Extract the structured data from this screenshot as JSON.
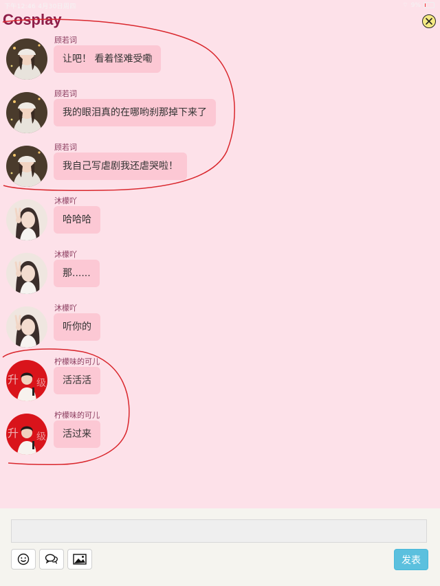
{
  "status_bar": {
    "time": "下午12:46",
    "date": "4月30日周四",
    "battery": "9%",
    "battery_level": 0.09
  },
  "app": {
    "title": "Cosplay"
  },
  "messages": [
    {
      "sender": "顾若词",
      "text": "让吧！  看着怪难受嘞",
      "avatar": "girl-beanie-avatar"
    },
    {
      "sender": "顾若词",
      "text": "我的眼泪真的在哪哟刹那掉下来了",
      "avatar": "girl-beanie-avatar"
    },
    {
      "sender": "顾若词",
      "text": "我自己写虐剧我还虐哭啦！",
      "avatar": "girl-beanie-avatar"
    },
    {
      "sender": "沐檬吖",
      "text": "哈哈哈",
      "avatar": "girl-peace-sign-avatar"
    },
    {
      "sender": "沐檬吖",
      "text": "那......",
      "avatar": "girl-peace-sign-avatar"
    },
    {
      "sender": "沐檬吖",
      "text": "听你的",
      "avatar": "girl-peace-sign-avatar"
    },
    {
      "sender": "柠檬味的可儿",
      "text": "活活活",
      "avatar": "boy-red-backdrop-avatar"
    },
    {
      "sender": "柠檬味的可儿",
      "text": "活过来",
      "avatar": "boy-red-backdrop-avatar"
    }
  ],
  "composer": {
    "input_value": "",
    "send_label": "发表",
    "tools": [
      "emoji-icon",
      "chat-bubbles-icon",
      "image-icon"
    ]
  },
  "colors": {
    "background": "#fde1e9",
    "title": "#8e1e49",
    "bubble": "#fcc8d4",
    "send_button": "#5bc0de",
    "annotation_ink": "#d9262c"
  }
}
